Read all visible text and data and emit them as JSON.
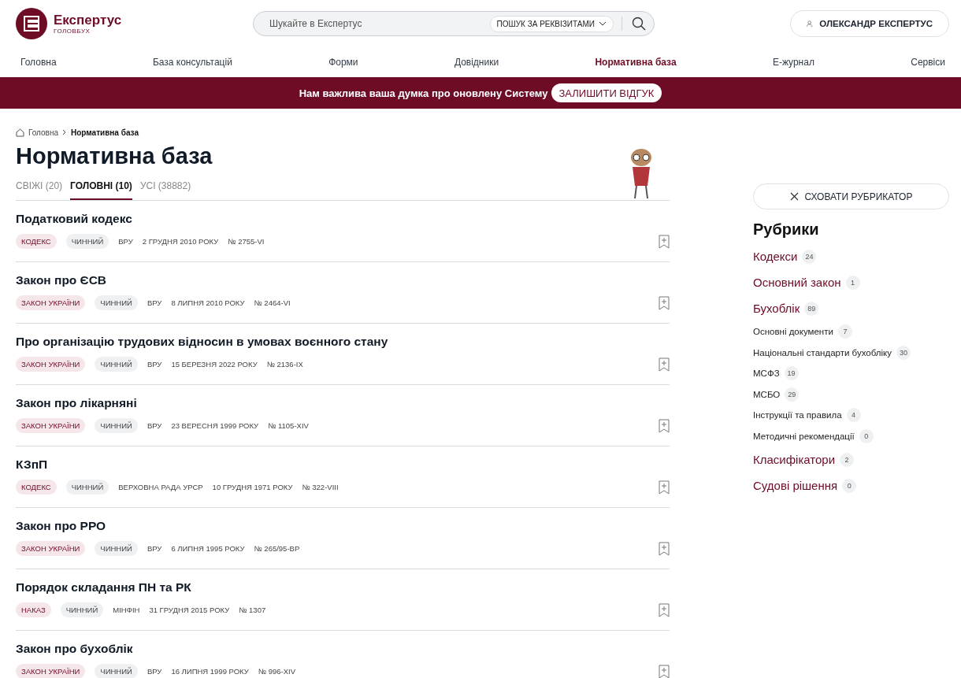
{
  "header": {
    "logo": {
      "name": "Експертус",
      "subtitle": "ГОЛОВБУХ"
    },
    "search": {
      "placeholder": "Шукайте в Експертус",
      "mode_button": "ПОШУК ЗА РЕКВІЗИТАМИ"
    },
    "user": "ОЛЕКСАНДР ЕКСПЕРТУС"
  },
  "nav": [
    {
      "label": "Головна",
      "selected": false
    },
    {
      "label": "База консультацій",
      "selected": false
    },
    {
      "label": "Форми",
      "selected": false
    },
    {
      "label": "Довідники",
      "selected": false
    },
    {
      "label": "Нормативна база",
      "selected": true
    },
    {
      "label": "Е-журнал",
      "selected": false
    },
    {
      "label": "Сервіси",
      "selected": false
    }
  ],
  "banner": {
    "text": "Нам важлива ваша думка про оновлену Систему",
    "button": "ЗАЛИШИТИ ВІДГУК"
  },
  "breadcrumb": [
    "Головна",
    "Нормативна база"
  ],
  "title": "Нормативна база",
  "tabs": [
    {
      "label": "СВІЖІ (20)",
      "selected": false
    },
    {
      "label": "ГОЛОВНІ (10)",
      "selected": true
    },
    {
      "label": "УСІ (38882)",
      "selected": false
    }
  ],
  "documents": [
    {
      "title": "Податковий кодекс",
      "type": "КОДЕКС",
      "status": "ЧИННИЙ",
      "issuer": "ВРУ",
      "date": "2 ГРУДНЯ 2010 РОКУ",
      "number": "№ 2755-VI"
    },
    {
      "title": "Закон про ЄСВ",
      "type": "ЗАКОН УКРАЇНИ",
      "status": "ЧИННИЙ",
      "issuer": "ВРУ",
      "date": "8 ЛИПНЯ 2010 РОКУ",
      "number": "№ 2464-VI"
    },
    {
      "title": "Про організацію трудових відносин в умовах воєнного стану",
      "type": "ЗАКОН УКРАЇНИ",
      "status": "ЧИННИЙ",
      "issuer": "ВРУ",
      "date": "15 БЕРЕЗНЯ 2022 РОКУ",
      "number": "№ 2136-IX"
    },
    {
      "title": "Закон про лікарняні",
      "type": "ЗАКОН УКРАЇНИ",
      "status": "ЧИННИЙ",
      "issuer": "ВРУ",
      "date": "23 ВЕРЕСНЯ 1999 РОКУ",
      "number": "№ 1105-XIV"
    },
    {
      "title": "КЗпП",
      "type": "КОДЕКС",
      "status": "ЧИННИЙ",
      "issuer": "ВЕРХОВНА РАДА УРСР",
      "date": "10 ГРУДНЯ 1971 РОКУ",
      "number": "№ 322-VIII"
    },
    {
      "title": "Закон про РРО",
      "type": "ЗАКОН УКРАЇНИ",
      "status": "ЧИННИЙ",
      "issuer": "ВРУ",
      "date": "6 ЛИПНЯ 1995 РОКУ",
      "number": "№ 265/95-ВР"
    },
    {
      "title": "Порядок складання ПН та РК",
      "type": "НАКАЗ",
      "status": "ЧИННИЙ",
      "issuer": "МІНФІН",
      "date": "31 ГРУДНЯ 2015 РОКУ",
      "number": "№ 1307"
    },
    {
      "title": "Закон про бухоблік",
      "type": "ЗАКОН УКРАЇНИ",
      "status": "ЧИННИЙ",
      "issuer": "ВРУ",
      "date": "16 ЛИПНЯ 1999 РОКУ",
      "number": "№ 996-XIV"
    }
  ],
  "sidebar": {
    "hide_button": "СХОВАТИ РУБРИКАТОР",
    "heading": "Рубрики",
    "rubrics": [
      {
        "label": "Кодекси",
        "count": "24"
      },
      {
        "label": "Основний закон",
        "count": "1"
      },
      {
        "label": "Бухоблік",
        "count": "89",
        "children": [
          {
            "label": "Основні документи",
            "count": "7"
          },
          {
            "label": "Національні стандарти бухобліку",
            "count": "30"
          },
          {
            "label": "МСФЗ",
            "count": "19"
          },
          {
            "label": "МСБО",
            "count": "29"
          },
          {
            "label": "Інструкції та правила",
            "count": "4"
          },
          {
            "label": "Методичні рекомендації",
            "count": "0"
          }
        ]
      },
      {
        "label": "Класифікатори",
        "count": "2"
      },
      {
        "label": "Судові рішення",
        "count": "0"
      }
    ]
  }
}
